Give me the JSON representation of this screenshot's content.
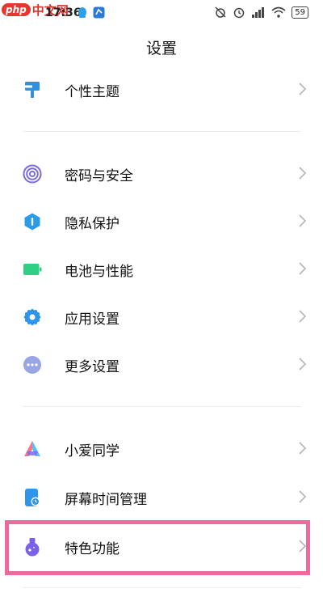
{
  "status_bar": {
    "time": "17:36",
    "battery": "59",
    "watermark_php": "php",
    "watermark_cn": "中文网"
  },
  "header": {
    "title": "设置"
  },
  "items": [
    {
      "label": "个性主题",
      "icon": "paintbrush-icon",
      "color": "#2f8fe0"
    },
    {
      "label": "密码与安全",
      "icon": "fingerprint-icon",
      "color": "#7a6bd6"
    },
    {
      "label": "隐私保护",
      "icon": "privacy-shield-icon",
      "color": "#2b9be8"
    },
    {
      "label": "电池与性能",
      "icon": "battery-icon",
      "color": "#2fcf84"
    },
    {
      "label": "应用设置",
      "icon": "gear-icon",
      "color": "#2e95ea"
    },
    {
      "label": "更多设置",
      "icon": "more-dots-icon",
      "color": "#8f9ce0"
    },
    {
      "label": "小爱同学",
      "icon": "xiaoai-icon",
      "color": "#3dc3f0"
    },
    {
      "label": "屏幕时间管理",
      "icon": "screen-time-icon",
      "color": "#2e95ea"
    },
    {
      "label": "特色功能",
      "icon": "flask-icon",
      "color": "#7b61e8"
    }
  ],
  "highlight_color": "#ef6a9c"
}
